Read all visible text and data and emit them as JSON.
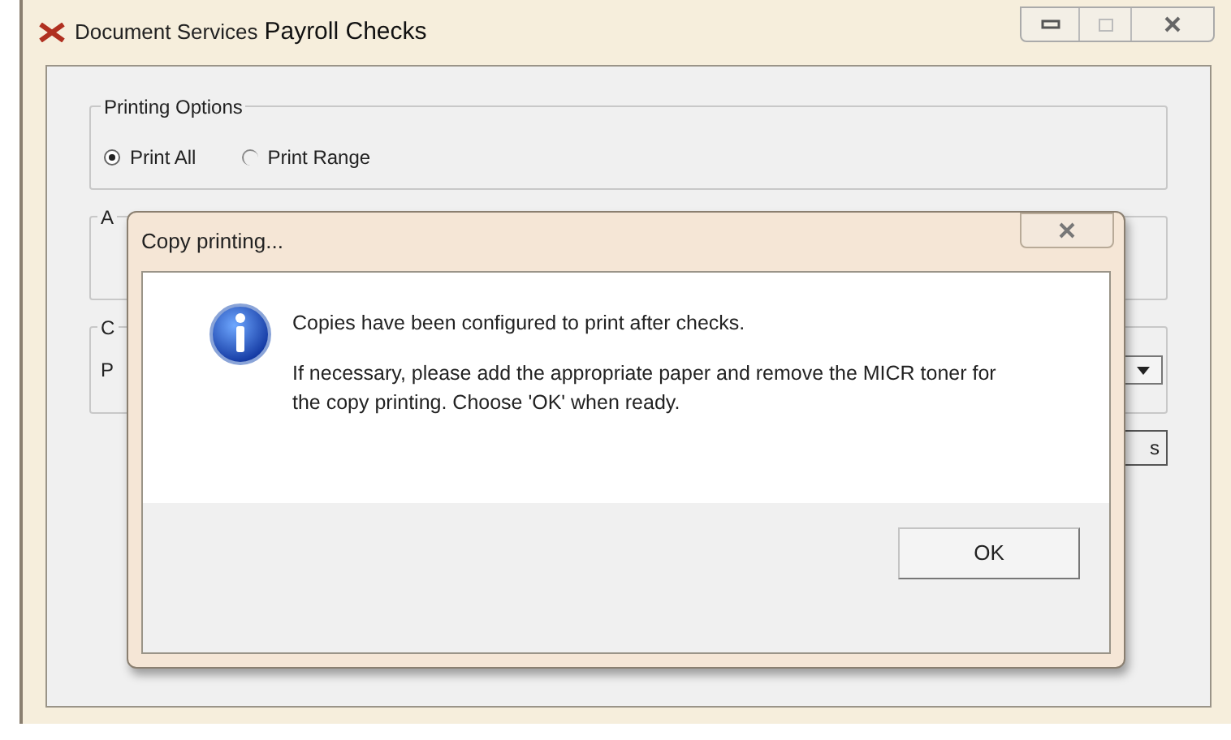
{
  "window": {
    "title_prefix": "Document Services",
    "title": "Payroll Checks"
  },
  "printing_options": {
    "label": "Printing Options",
    "radios": [
      {
        "label": "Print All",
        "selected": true
      },
      {
        "label": "Print Range",
        "selected": false
      }
    ]
  },
  "group_2": {
    "label": "A"
  },
  "group_3": {
    "label": "C",
    "field_label": "P"
  },
  "button_partial": "s",
  "dialog": {
    "title": "Copy printing...",
    "message": "Copies have been configured to print after checks.",
    "detail": "If necessary, please add the appropriate paper and remove the MICR toner for the copy printing.  Choose 'OK' when ready.",
    "buttons": [
      "OK"
    ]
  }
}
